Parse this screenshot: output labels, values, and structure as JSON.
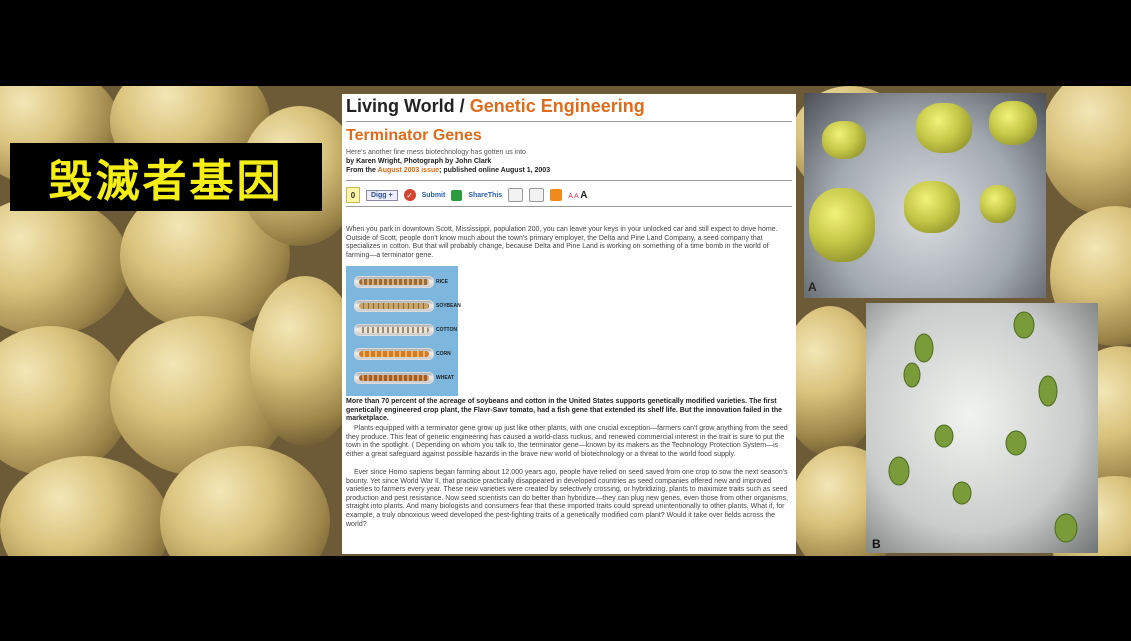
{
  "slide_title": "毁滅者基因",
  "article": {
    "section": "Living World",
    "separator": " / ",
    "category": "Genetic Engineering",
    "headline": "Terminator Genes",
    "dek": "Here's another fine mess biotechnology has gotten us into",
    "byline": "by Karen Wright, Photograph by John Clark",
    "published_prefix": "From the ",
    "issue_link": "August 2003 issue",
    "published_suffix": "; published online August 1, 2003",
    "toolbar": {
      "digg_count": "0",
      "digg_label": "Digg +",
      "submit_label": "Submit",
      "share_label": "ShareThis",
      "text_size_small": "A A",
      "text_size_large": "A"
    },
    "intro": "When you park in downtown Scott, Mississippi, population 200, you can leave your keys in your unlocked car and still expect to drive home. Outside of Scott, people don't know much about the town's primary employer, the Delta and Pine Land Company, a seed company that specializes in cotton. But that will probably change, because Delta and Pine Land is working on something of a time bomb in the world of farming—a terminator gene.",
    "figure_labels": [
      "RICE",
      "SOYBEAN",
      "COTTON",
      "CORN",
      "WHEAT"
    ],
    "caption": "More than 70 percent of the acreage of soybeans and cotton in the United States supports genetically modified varieties. The first genetically engineered crop plant, the Flavr-Savr tomato, had a fish gene that extended its shelf life. But the innovation failed in the marketplace.",
    "body_1": "Plants equipped with a terminator gene grow up just like other plants, with one crucial exception—farmers can't grow anything from the seed they produce. This feat of genetic engineering has caused a world-class ruckus, and renewed commercial interest in the trait is sure to put the town in the spotlight. ( Depending on whom you talk to, the terminator gene—known by its makers as the Technology Protection System—is either a great safeguard against possible hazards in the brave new world of biotechnology or a threat to the world food supply.",
    "body_2": "Ever since Homo sapiens began farming about 12,000 years ago, people have relied on seed saved from one crop to sow the next season's bounty. Yet since World War II, that practice practically disappeared in developed countries as seed companies offered new and improved varieties to farmers every year. These new varieties were created by selectively crossing, or hybridizing, plants to maximize traits such as seed production and pest resistance. Now seed scientists can do better than hybridize—they can plug new genes, even those from other organisms, straight into plants. And many biologists and consumers fear that these imported traits could spread unintentionally to other plants. What if, for example, a truly obnoxious weed developed the pest-fighting traits of a genetically modified corn plant? Would it take over fields across the world?"
  },
  "photos": {
    "a_label": "A",
    "b_label": "B"
  },
  "colors": {
    "title_yellow": "#f5ee14",
    "accent_orange": "#e06b1a",
    "link_blue": "#2a5ea8"
  }
}
